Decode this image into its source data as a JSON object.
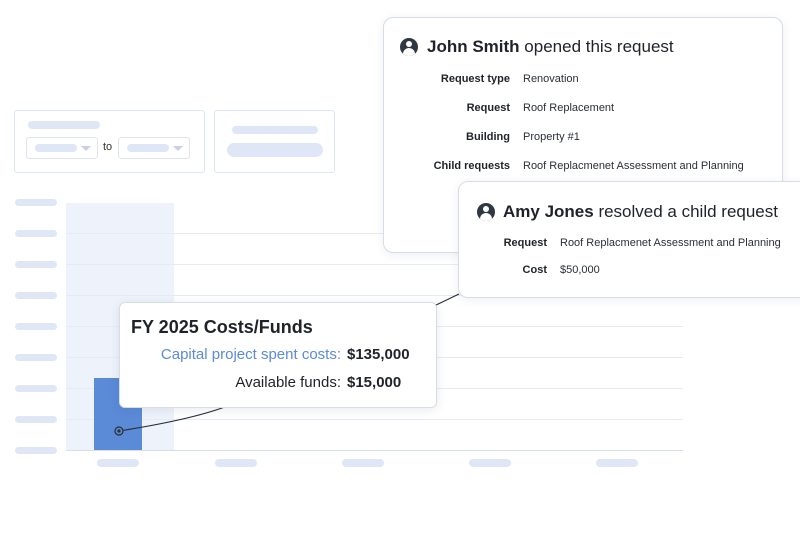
{
  "filters": {
    "range_separator": "to"
  },
  "tooltip": {
    "title": "FY 2025 Costs/Funds",
    "spent_label": "Capital project spent costs:",
    "spent_value": "$135,000",
    "funds_label": "Available funds:",
    "funds_value": "$15,000"
  },
  "request_card": {
    "author": "John Smith",
    "action": "opened this request",
    "fields": [
      {
        "label": "Request type",
        "value": "Renovation"
      },
      {
        "label": "Request",
        "value": "Roof Replacement"
      },
      {
        "label": "Building",
        "value": "Property #1"
      },
      {
        "label": "Child requests",
        "value": "Roof Replacmenet Assessment and Planning"
      }
    ]
  },
  "child_card": {
    "author": "Amy Jones",
    "action": "resolved a child request",
    "fields": [
      {
        "label": "Request",
        "value": "Roof Replacmenet Assessment and Planning"
      },
      {
        "label": "Cost",
        "value": "$50,000"
      }
    ]
  },
  "colors": {
    "accent": "#5b8ad6",
    "bar": "#5b8ad6",
    "highlight_column": "#eef2fb",
    "skeleton": "#dfe7f7"
  }
}
